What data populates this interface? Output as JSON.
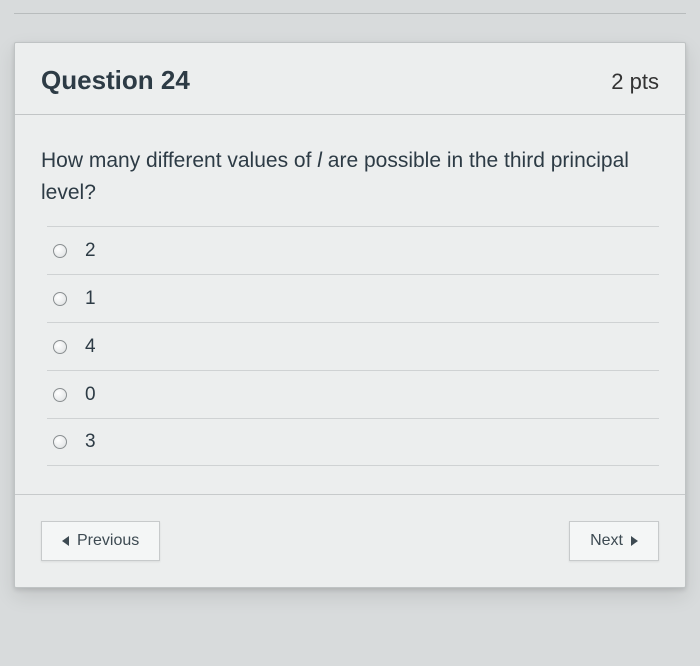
{
  "header": {
    "title": "Question 24",
    "points": "2 pts"
  },
  "question": {
    "text_before_var": "How many different values of ",
    "variable": "l",
    "text_after_var": " are possible in the third principal level?"
  },
  "options": [
    {
      "label": "2"
    },
    {
      "label": "1"
    },
    {
      "label": "4"
    },
    {
      "label": "0"
    },
    {
      "label": "3"
    }
  ],
  "nav": {
    "previous": "Previous",
    "next": "Next"
  }
}
